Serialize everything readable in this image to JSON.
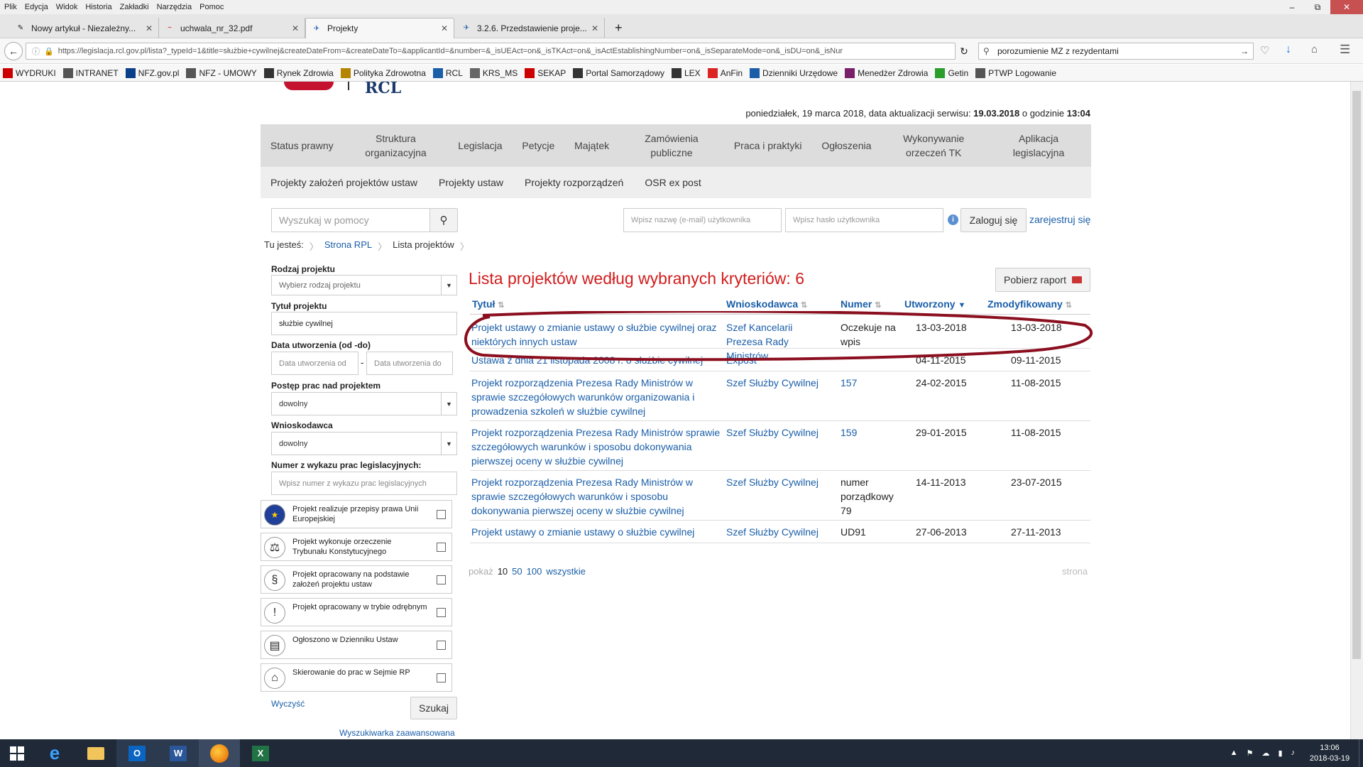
{
  "browser": {
    "menu": [
      "Plik",
      "Edycja",
      "Widok",
      "Historia",
      "Zakładki",
      "Narzędzia",
      "Pomoc"
    ],
    "tabs": [
      {
        "label": "Nowy artykuł - Niezależny...",
        "active": false
      },
      {
        "label": "uchwala_nr_32.pdf",
        "active": false
      },
      {
        "label": "Projekty",
        "active": true
      },
      {
        "label": "3.2.6. Przedstawienie proje...",
        "active": false
      }
    ],
    "url": "https://legislacja.rcl.gov.pl/lista?_typeId=1&title=służbie+cywilnej&createDateFrom=&createDateTo=&applicantId=&number=&_isUEAct=on&_isTKAct=on&_isActEstablishingNumber=on&_isSeparateMode=on&_isDU=on&_isNur",
    "search": "porozumienie MZ z rezydentami",
    "bookmarks": [
      {
        "label": "WYDRUKI",
        "color": "#c00"
      },
      {
        "label": "INTRANET",
        "color": "#555"
      },
      {
        "label": "NFZ.gov.pl",
        "color": "#0a3f8a"
      },
      {
        "label": "NFZ - UMOWY",
        "color": "#555"
      },
      {
        "label": "Rynek Zdrowia",
        "color": "#333"
      },
      {
        "label": "Polityka Zdrowotna",
        "color": "#b58400"
      },
      {
        "label": "RCL",
        "color": "#1a5ea8"
      },
      {
        "label": "KRS_MS",
        "color": "#666"
      },
      {
        "label": "SEKAP",
        "color": "#c00"
      },
      {
        "label": "Portal Samorządowy",
        "color": "#333"
      },
      {
        "label": "LEX",
        "color": "#333"
      },
      {
        "label": "AnFin",
        "color": "#d22"
      },
      {
        "label": "Dzienniki Urzędowe",
        "color": "#1a5ea8"
      },
      {
        "label": "Menedżer Zdrowia",
        "color": "#7a1f6a"
      },
      {
        "label": "Getin",
        "color": "#2a9d2a"
      },
      {
        "label": "PTWP Logowanie",
        "color": "#555"
      }
    ]
  },
  "site": {
    "logo": "RCL",
    "date_line": {
      "prefix": "poniedziałek, 19 marca 2018, data aktualizacji serwisu: ",
      "date": "19.03.2018",
      "mid": " o godzinie ",
      "time": "13:04"
    },
    "main_nav": [
      "Status prawny",
      "Struktura organizacyjna",
      "Legislacja",
      "Petycje",
      "Majątek",
      "Zamówienia publiczne",
      "Praca i praktyki",
      "Ogłoszenia",
      "Wykonywanie orzeczeń TK",
      "Aplikacja legislacyjna"
    ],
    "sub_nav": [
      "Projekty założeń projektów ustaw",
      "Projekty ustaw",
      "Projekty rozporządzeń",
      "OSR ex post"
    ],
    "help_search_placeholder": "Wyszukaj w pomocy",
    "login": {
      "user_placeholder": "Wpisz nazwę (e-mail) użytkownika",
      "pass_placeholder": "Wpisz hasło użytkownika",
      "login_btn": "Zaloguj się",
      "register": "zarejestruj się"
    },
    "breadcrumb": {
      "prefix": "Tu jesteś:",
      "items": [
        "Strona RPL",
        "Lista projektów"
      ]
    }
  },
  "filters": {
    "type_label": "Rodzaj projektu",
    "type_placeholder": "Wybierz rodzaj projektu",
    "title_label": "Tytuł projektu",
    "title_value": "służbie cywilnej",
    "date_label": "Data utworzenia (od -do)",
    "date_from_ph": "Data utworzenia od",
    "date_sep": "-",
    "date_to_ph": "Data utworzenia do",
    "progress_label": "Postęp prac nad projektem",
    "progress_value": "dowolny",
    "applicant_label": "Wnioskodawca",
    "applicant_value": "dowolny",
    "number_label": "Numer z wykazu prac legislacyjnych:",
    "number_ph": "Wpisz numer z wykazu prac legislacyjnych",
    "checks": [
      {
        "label": "Projekt realizuje przepisy prawa Unii Europejskiej",
        "icon": "eu-flag-icon"
      },
      {
        "label": "Projekt wykonuje orzeczenie Trybunału Konstytucyjnego",
        "icon": "judge-icon"
      },
      {
        "label": "Projekt opracowany na podstawie założeń projektu ustaw",
        "icon": "paragraph-icon"
      },
      {
        "label": "Projekt opracowany w trybie odrębnym",
        "icon": "exclamation-icon"
      },
      {
        "label": "Ogłoszono w Dzienniku Ustaw",
        "icon": "document-icon"
      },
      {
        "label": "Skierowanie do prac w Sejmie RP",
        "icon": "sejm-icon"
      }
    ],
    "clear": "Wyczyść",
    "search_btn": "Szukaj",
    "advanced": "Wyszukiwarka zaawansowana"
  },
  "results": {
    "heading": "Lista projektów według wybranych kryteriów: 6",
    "report_btn": "Pobierz raport",
    "columns": [
      "Tytuł",
      "Wnioskodawca",
      "Numer",
      "Utworzony",
      "Zmodyfikowany"
    ],
    "rows": [
      {
        "title": "Projekt ustawy o zmianie ustawy o służbie cywilnej oraz niektórych innych ustaw",
        "applicant": "Szef Kancelarii Prezesa Rady Ministrów",
        "number": "Oczekuje na wpis",
        "created": "13-03-2018",
        "modified": "13-03-2018"
      },
      {
        "title": "Ustawa z dnia 21 listopada 2008 r. o służbie cywilnej",
        "applicant": "Expost",
        "number": "",
        "created": "04-11-2015",
        "modified": "09-11-2015"
      },
      {
        "title": "Projekt rozporządzenia Prezesa Rady Ministrów w sprawie szczegółowych warunków organizowania i prowadzenia szkoleń w służbie cywilnej",
        "applicant": "Szef Służby Cywilnej",
        "number": "157",
        "created": "24-02-2015",
        "modified": "11-08-2015"
      },
      {
        "title": "Projekt rozporządzenia Prezesa Rady Ministrów sprawie szczegółowych warunków i sposobu dokonywania pierwszej oceny w służbie cywilnej",
        "applicant": "Szef Służby Cywilnej",
        "number": "159",
        "created": "29-01-2015",
        "modified": "11-08-2015"
      },
      {
        "title": "Projekt rozporządzenia Prezesa Rady Ministrów w sprawie szczegółowych warunków i sposobu dokonywania pierwszej oceny w służbie cywilnej",
        "applicant": "Szef Służby Cywilnej",
        "number": "numer porządkowy 79",
        "created": "14-11-2013",
        "modified": "23-07-2015"
      },
      {
        "title": "Projekt ustawy o zmianie ustawy o służbie cywilnej",
        "applicant": "Szef Służby Cywilnej",
        "number": "UD91",
        "created": "27-06-2013",
        "modified": "27-11-2013"
      }
    ],
    "pager": {
      "label": "pokaż",
      "current": "10",
      "opts": [
        "50",
        "100",
        "wszystkie"
      ],
      "page_label": "strona"
    }
  },
  "taskbar": {
    "time": "13:06",
    "date": "2018-03-19"
  }
}
